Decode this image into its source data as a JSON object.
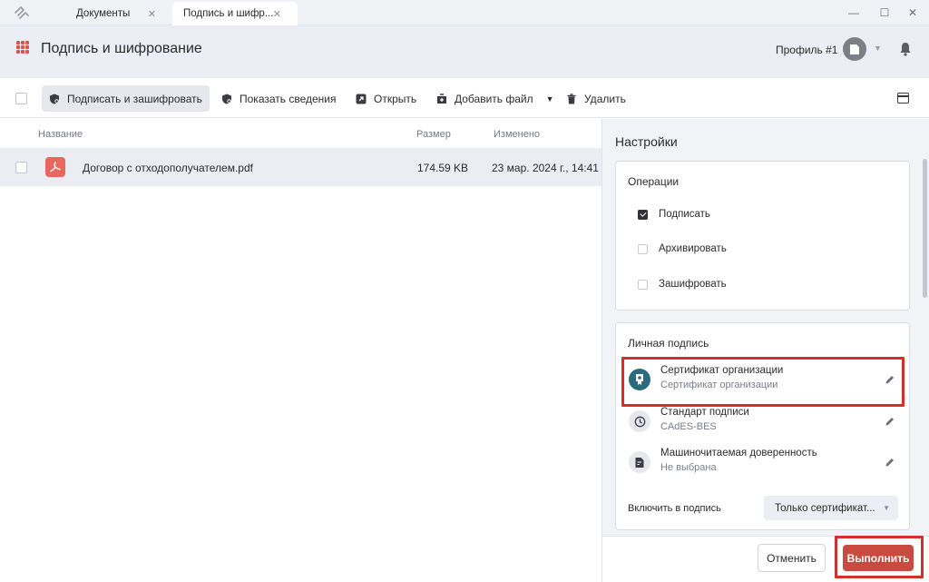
{
  "tabs": [
    {
      "label": "Документы"
    },
    {
      "label": "Подпись и шифр..."
    }
  ],
  "header": {
    "title": "Подпись и шифрование",
    "profile": "Профиль #1"
  },
  "toolbar": {
    "sign_encrypt": "Подписать и зашифровать",
    "show_info": "Показать сведения",
    "open": "Открыть",
    "add_file": "Добавить файл",
    "delete": "Удалить"
  },
  "list": {
    "columns": {
      "name": "Название",
      "size": "Размер",
      "modified": "Изменено"
    },
    "rows": [
      {
        "name": "Договор с отходополучателем.pdf",
        "size": "174.59 KB",
        "modified": "23 мар. 2024 г., 14:41"
      }
    ]
  },
  "settings": {
    "title": "Настройки",
    "operations": {
      "title": "Операции",
      "items": [
        {
          "label": "Подписать",
          "checked": true
        },
        {
          "label": "Архивировать",
          "checked": false
        },
        {
          "label": "Зашифровать",
          "checked": false
        }
      ]
    },
    "signature": {
      "title": "Личная подпись",
      "items": [
        {
          "title": "Сертификат организации",
          "subtitle": "Сертификат организации",
          "icon": "certificate-icon"
        },
        {
          "title": "Стандарт подписи",
          "subtitle": "CAdES-BES",
          "icon": "clock-icon"
        },
        {
          "title": "Машиночитаемая доверенность",
          "subtitle": "Не выбрана",
          "icon": "document-icon"
        }
      ],
      "include_label": "Включить в подпись",
      "include_value": "Только сертификат..."
    }
  },
  "footer": {
    "cancel": "Отменить",
    "run": "Выполнить"
  },
  "colors": {
    "accent": "#c94a3e",
    "highlight": "#d32f2f",
    "teal": "#2c6b7d"
  }
}
